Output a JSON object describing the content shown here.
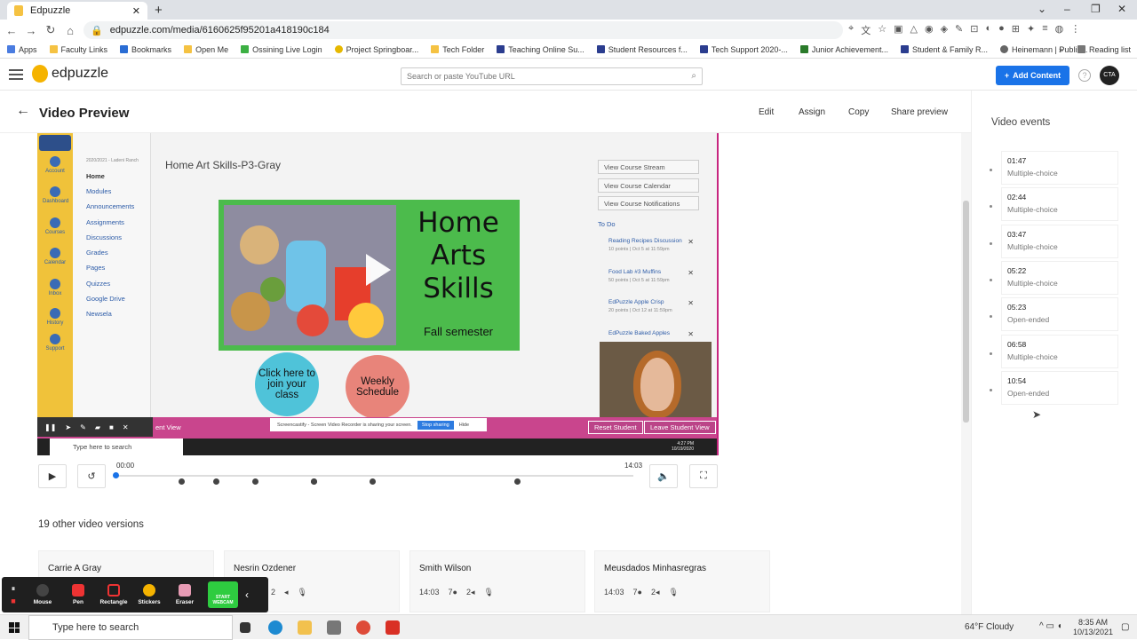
{
  "browser": {
    "tab_title": "Edpuzzle",
    "url": "edpuzzle.com/media/6160625f95201a418190c184",
    "bookmarks": [
      "Apps",
      "Faculty Links",
      "Bookmarks",
      "Open Me",
      "Ossining Live Login",
      "Project Springboar...",
      "Tech Folder",
      "Teaching Online Su...",
      "Student Resources f...",
      "Tech Support 2020-...",
      "Junior Achievement...",
      "Student & Family R...",
      "Heinemann | Publis..."
    ],
    "reading_list": "Reading list"
  },
  "header": {
    "logo_text": "edpuzzle",
    "search_placeholder": "Search or paste YouTube URL",
    "add_content": "Add Content",
    "avatar_initials": "CTA"
  },
  "subheader": {
    "title": "Video Preview",
    "actions": [
      "Edit",
      "Assign",
      "Copy",
      "Share preview"
    ]
  },
  "video": {
    "lms_nav": [
      "Home",
      "Modules",
      "Announcements",
      "Assignments",
      "Discussions",
      "Grades",
      "Pages",
      "Quizzes",
      "Google Drive",
      "Newsela"
    ],
    "lms_left": [
      "Account",
      "Dashboard",
      "Courses",
      "Calendar",
      "Inbox",
      "History",
      "Support"
    ],
    "term": "2020/2021 - Ladeni Ranch",
    "course_title": "Home Art Skills-P3-Gray",
    "banner_line1": "Home",
    "banner_line2": "Arts",
    "banner_line3": "Skills",
    "banner_sub": "Fall semester",
    "circle1": "Click here to join your class",
    "circle2": "Weekly Schedule",
    "right_buttons": [
      "View Course Stream",
      "View Course Calendar",
      "View Course Notifications"
    ],
    "todo_head": "To Do",
    "todos": [
      {
        "title": "Reading Recipes Discussion",
        "sub": "10 points  |  Oct 5 at 11:59pm"
      },
      {
        "title": "Food Lab #3 Muffins",
        "sub": "50 points  |  Oct 5 at 11:59pm"
      },
      {
        "title": "EdPuzzle Apple Crisp",
        "sub": "20 points  |  Oct 12 at 11:59pm"
      },
      {
        "title": "EdPuzzle Baked Apples",
        "sub": ""
      }
    ],
    "student_view": "ent View",
    "share_msg": "Screencastify - Screen Video Recorder is sharing your screen.",
    "stop_sharing": "Stop sharing",
    "hide": "Hide",
    "reset_student": "Reset Student",
    "leave_student": "Leave Student View",
    "win_search": "Type here to search",
    "win_time": "4:27 PM",
    "win_date": "10/19/2020"
  },
  "player": {
    "time_start": "00:00",
    "time_end": "14:03",
    "progress": 0.0,
    "markers_seconds": [
      107,
      164,
      227,
      322,
      323,
      418,
      654
    ]
  },
  "other_versions": {
    "title": "19 other video versions",
    "cards": [
      {
        "name": "Carrie A Gray",
        "duration": "",
        "questions": "",
        "notes": ""
      },
      {
        "name": "Nesrin Ozdener",
        "duration": "",
        "questions": "",
        "notes": "2"
      },
      {
        "name": "Smith Wilson",
        "duration": "14:03",
        "questions": "7",
        "notes": "2"
      },
      {
        "name": "Meusdados Minhasregras",
        "duration": "14:03",
        "questions": "7",
        "notes": "2"
      }
    ]
  },
  "video_events": {
    "title": "Video events",
    "items": [
      {
        "time": "01:47",
        "type": "Multiple-choice"
      },
      {
        "time": "02:44",
        "type": "Multiple-choice"
      },
      {
        "time": "03:47",
        "type": "Multiple-choice"
      },
      {
        "time": "05:22",
        "type": "Multiple-choice"
      },
      {
        "time": "05:23",
        "type": "Open-ended"
      },
      {
        "time": "06:58",
        "type": "Multiple-choice"
      },
      {
        "time": "10:54",
        "type": "Open-ended"
      }
    ]
  },
  "screencastify": {
    "tools": [
      "Mouse",
      "Pen",
      "Rectangle",
      "Stickers",
      "Eraser"
    ],
    "webcam": "START WEBCAM"
  },
  "taskbar": {
    "search": "Type here to search",
    "weather": "64°F  Cloudy",
    "time": "8:35 AM",
    "date": "10/13/2021"
  }
}
